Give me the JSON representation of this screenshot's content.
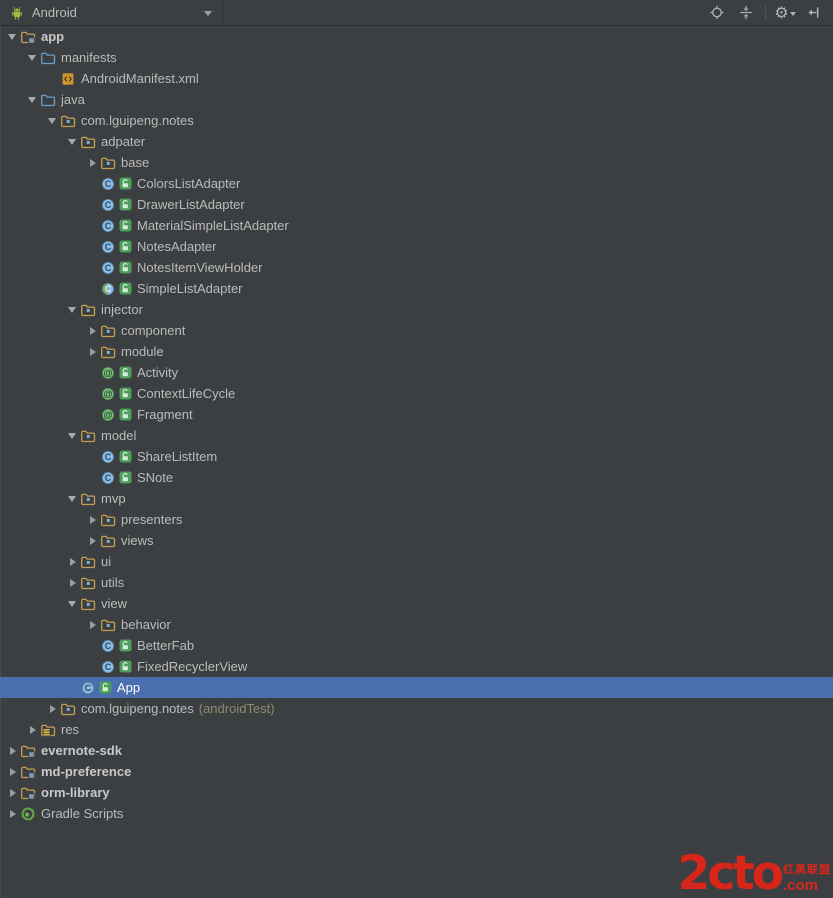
{
  "colors": {
    "background": "#3C3F41",
    "selection": "#4B6EAF",
    "text": "#BBBBBB",
    "suffix_text": "#8C8C6E",
    "watermark_red": "#D8261B"
  },
  "toolbar": {
    "mode_selector": {
      "label": "Android",
      "icon": "android-robot"
    },
    "actions": [
      {
        "name": "locate",
        "icon": "crosshair-target"
      },
      {
        "name": "collapse-all",
        "icon": "collapse-all"
      },
      {
        "type": "separator"
      },
      {
        "name": "settings",
        "icon": "gear"
      },
      {
        "name": "hide-panel",
        "icon": "hide-panel"
      }
    ]
  },
  "tree": {
    "rows": [
      {
        "label": "app",
        "level": 0,
        "expand": "open",
        "icon": "module-folder",
        "bold": true
      },
      {
        "label": "manifests",
        "level": 1,
        "expand": "open",
        "icon": "folder-blue"
      },
      {
        "label": "AndroidManifest.xml",
        "level": 2,
        "expand": null,
        "icon": "manifest-file"
      },
      {
        "label": "java",
        "level": 1,
        "expand": "open",
        "icon": "folder-blue"
      },
      {
        "label": "com.lguipeng.notes",
        "level": 2,
        "expand": "open",
        "icon": "package-folder"
      },
      {
        "label": "adpater",
        "level": 3,
        "expand": "open",
        "icon": "package-folder"
      },
      {
        "label": "base",
        "level": 4,
        "expand": "closed",
        "icon": "package-folder"
      },
      {
        "label": "ColorsListAdapter",
        "level": 4,
        "expand": null,
        "icon": "class",
        "badge": "unlocked"
      },
      {
        "label": "DrawerListAdapter",
        "level": 4,
        "expand": null,
        "icon": "class",
        "badge": "unlocked"
      },
      {
        "label": "MaterialSimpleListAdapter",
        "level": 4,
        "expand": null,
        "icon": "class",
        "badge": "unlocked"
      },
      {
        "label": "NotesAdapter",
        "level": 4,
        "expand": null,
        "icon": "class",
        "badge": "unlocked"
      },
      {
        "label": "NotesItemViewHolder",
        "level": 4,
        "expand": null,
        "icon": "class",
        "badge": "unlocked"
      },
      {
        "label": "SimpleListAdapter",
        "level": 4,
        "expand": null,
        "icon": "class-green",
        "badge": "unlocked"
      },
      {
        "label": "injector",
        "level": 3,
        "expand": "open",
        "icon": "package-folder"
      },
      {
        "label": "component",
        "level": 4,
        "expand": "closed",
        "icon": "package-folder"
      },
      {
        "label": "module",
        "level": 4,
        "expand": "closed",
        "icon": "package-folder"
      },
      {
        "label": "Activity",
        "level": 4,
        "expand": null,
        "icon": "annotation",
        "badge": "unlocked"
      },
      {
        "label": "ContextLifeCycle",
        "level": 4,
        "expand": null,
        "icon": "annotation",
        "badge": "unlocked"
      },
      {
        "label": "Fragment",
        "level": 4,
        "expand": null,
        "icon": "annotation",
        "badge": "unlocked"
      },
      {
        "label": "model",
        "level": 3,
        "expand": "open",
        "icon": "package-folder"
      },
      {
        "label": "ShareListItem",
        "level": 4,
        "expand": null,
        "icon": "class",
        "badge": "unlocked"
      },
      {
        "label": "SNote",
        "level": 4,
        "expand": null,
        "icon": "class",
        "badge": "unlocked"
      },
      {
        "label": "mvp",
        "level": 3,
        "expand": "open",
        "icon": "package-folder"
      },
      {
        "label": "presenters",
        "level": 4,
        "expand": "closed",
        "icon": "package-folder"
      },
      {
        "label": "views",
        "level": 4,
        "expand": "closed",
        "icon": "package-folder"
      },
      {
        "label": "ui",
        "level": 3,
        "expand": "closed",
        "icon": "package-folder"
      },
      {
        "label": "utils",
        "level": 3,
        "expand": "closed",
        "icon": "package-folder"
      },
      {
        "label": "view",
        "level": 3,
        "expand": "open",
        "icon": "package-folder"
      },
      {
        "label": "behavior",
        "level": 4,
        "expand": "closed",
        "icon": "package-folder"
      },
      {
        "label": "BetterFab",
        "level": 4,
        "expand": null,
        "icon": "class",
        "badge": "unlocked"
      },
      {
        "label": "FixedRecyclerView",
        "level": 4,
        "expand": null,
        "icon": "class",
        "badge": "unlocked"
      },
      {
        "label": "App",
        "level": 3,
        "expand": null,
        "icon": "class",
        "badge": "unlocked",
        "selected": true
      },
      {
        "label": "com.lguipeng.notes",
        "suffix": "(androidTest)",
        "level": 2,
        "expand": "closed",
        "icon": "package-folder"
      },
      {
        "label": "res",
        "level": 1,
        "expand": "closed",
        "icon": "res-folder"
      },
      {
        "label": "evernote-sdk",
        "level": 0,
        "expand": "closed",
        "icon": "module-folder",
        "bold": true
      },
      {
        "label": "md-preference",
        "level": 0,
        "expand": "closed",
        "icon": "module-folder",
        "bold": true
      },
      {
        "label": "orm-library",
        "level": 0,
        "expand": "closed",
        "icon": "module-folder",
        "bold": true
      },
      {
        "label": "Gradle Scripts",
        "level": 0,
        "expand": "closed",
        "icon": "gradle"
      }
    ]
  },
  "watermark": {
    "brand": "2cto",
    "caption": "红黑联盟",
    "tld": ".com"
  }
}
